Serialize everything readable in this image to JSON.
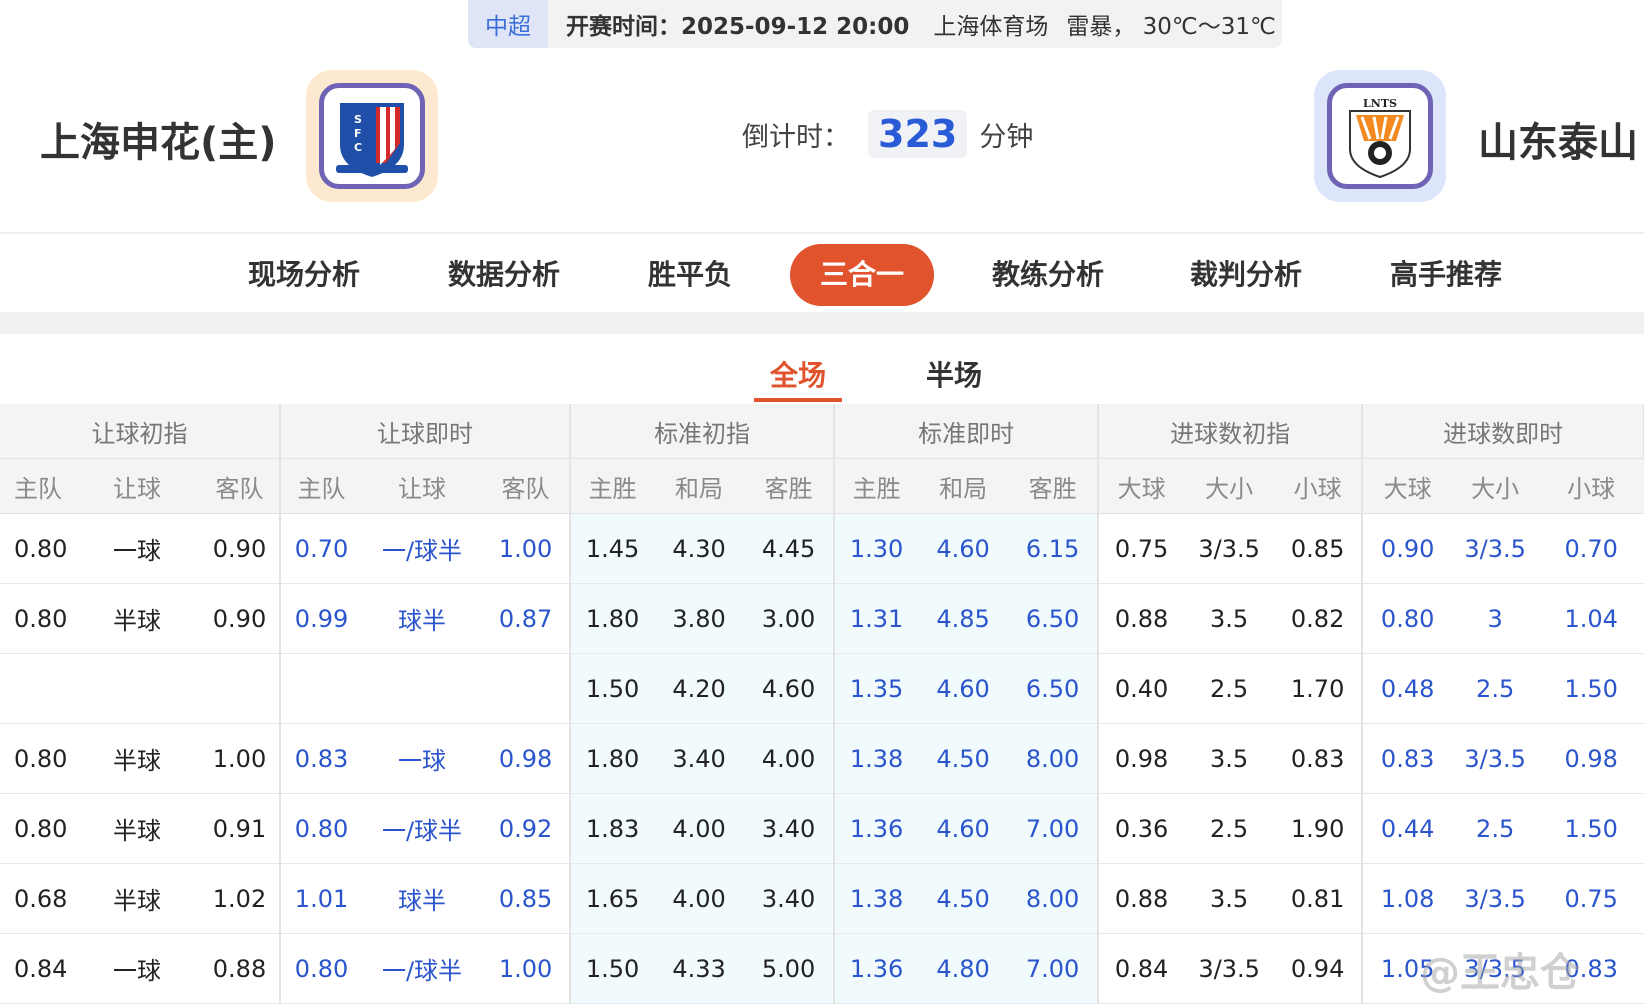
{
  "infobar": {
    "league": "中超",
    "kickoff": "开赛时间：2025-09-12 20:00",
    "venue": "上海体育场",
    "weather": "雷暴， 30℃～31℃"
  },
  "match": {
    "home_name": "上海申花(主)",
    "away_name": "山东泰山",
    "countdown_label": "倒计时：",
    "countdown_value": "323",
    "countdown_unit": "分钟",
    "home_logo_text": "SFC",
    "away_logo_text": "LNTS"
  },
  "tabs": [
    "现场分析",
    "数据分析",
    "胜平负",
    "三合一",
    "教练分析",
    "裁判分析",
    "高手推荐"
  ],
  "active_tab": "三合一",
  "subtabs": [
    "全场",
    "半场"
  ],
  "active_subtab": "全场",
  "table": {
    "groups": [
      "让球初指",
      "让球即时",
      "标准初指",
      "标准即时",
      "进球数初指",
      "进球数即时"
    ],
    "subheaders": [
      "主队",
      "让球",
      "客队",
      "主队",
      "让球",
      "客队",
      "主胜",
      "和局",
      "客胜",
      "主胜",
      "和局",
      "客胜",
      "大球",
      "大小",
      "小球",
      "大球",
      "大小",
      "小球"
    ],
    "rows": [
      [
        "0.80",
        "一球",
        "0.90",
        "0.70",
        "一/球半",
        "1.00",
        "1.45",
        "4.30",
        "4.45",
        "1.30",
        "4.60",
        "6.15",
        "0.75",
        "3/3.5",
        "0.85",
        "0.90",
        "3/3.5",
        "0.70"
      ],
      [
        "0.80",
        "半球",
        "0.90",
        "0.99",
        "球半",
        "0.87",
        "1.80",
        "3.80",
        "3.00",
        "1.31",
        "4.85",
        "6.50",
        "0.88",
        "3.5",
        "0.82",
        "0.80",
        "3",
        "1.04"
      ],
      [
        "",
        "",
        "",
        "",
        "",
        "",
        "1.50",
        "4.20",
        "4.60",
        "1.35",
        "4.60",
        "6.50",
        "0.40",
        "2.5",
        "1.70",
        "0.48",
        "2.5",
        "1.50"
      ],
      [
        "0.80",
        "半球",
        "1.00",
        "0.83",
        "一球",
        "0.98",
        "1.80",
        "3.40",
        "4.00",
        "1.38",
        "4.50",
        "8.00",
        "0.98",
        "3.5",
        "0.83",
        "0.83",
        "3/3.5",
        "0.98"
      ],
      [
        "0.80",
        "半球",
        "0.91",
        "0.80",
        "一/球半",
        "0.92",
        "1.83",
        "4.00",
        "3.40",
        "1.36",
        "4.60",
        "7.00",
        "0.36",
        "2.5",
        "1.90",
        "0.44",
        "2.5",
        "1.50"
      ],
      [
        "0.68",
        "半球",
        "1.02",
        "1.01",
        "球半",
        "0.85",
        "1.65",
        "4.00",
        "3.40",
        "1.38",
        "4.50",
        "8.00",
        "0.88",
        "3.5",
        "0.81",
        "1.08",
        "3/3.5",
        "0.75"
      ],
      [
        "0.84",
        "一球",
        "0.88",
        "0.80",
        "一/球半",
        "1.00",
        "1.50",
        "4.33",
        "5.00",
        "1.36",
        "4.80",
        "7.00",
        "0.84",
        "3/3.5",
        "0.94",
        "1.05",
        "3/3.5",
        "0.83"
      ]
    ]
  },
  "watermark": "@王忠仓",
  "colors": {
    "accent": "#e0532c",
    "live_blue": "#2a55cc",
    "countdown_blue": "#2a5bd7",
    "league_blue": "#3b6fd8"
  }
}
